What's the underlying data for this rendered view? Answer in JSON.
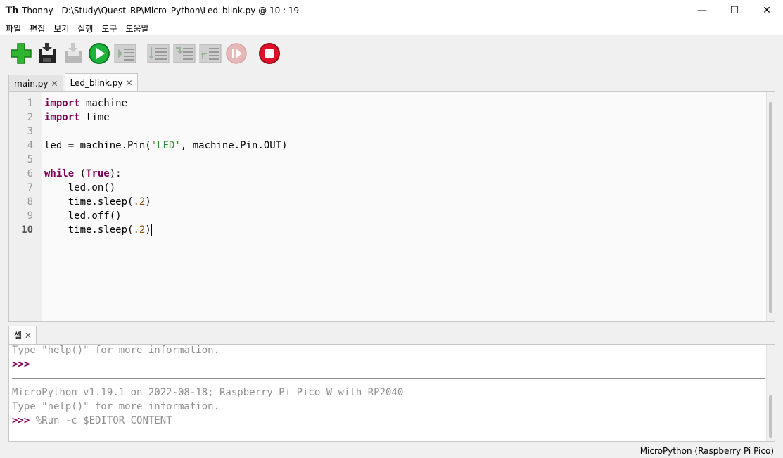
{
  "window": {
    "title": "Thonny  -  D:\\Study\\Quest_RP\\Micro_Python\\Led_blink.py  @  10 : 19",
    "minimize_glyph": "—",
    "maximize_glyph": "☐",
    "close_glyph": "✕"
  },
  "menu": {
    "items": [
      {
        "label": "파일"
      },
      {
        "label": "편집"
      },
      {
        "label": "보기"
      },
      {
        "label": "실행"
      },
      {
        "label": "도구"
      },
      {
        "label": "도움말"
      }
    ]
  },
  "toolbar": {
    "buttons": [
      {
        "icon": "new-file-icon",
        "enabled": true
      },
      {
        "icon": "save-icon",
        "enabled": true
      },
      {
        "icon": "load-icon",
        "enabled": false
      },
      {
        "icon": "run-icon",
        "enabled": true
      },
      {
        "icon": "debug-icon",
        "enabled": false
      },
      {
        "icon": "step-over-icon",
        "enabled": false
      },
      {
        "icon": "step-into-icon",
        "enabled": false
      },
      {
        "icon": "step-out-icon",
        "enabled": false
      },
      {
        "icon": "resume-icon",
        "enabled": false
      },
      {
        "icon": "stop-icon",
        "enabled": true
      }
    ],
    "colors": {
      "run": "#1bb33a",
      "stop": "#e0102a",
      "new": "#2fb52f"
    }
  },
  "editor": {
    "tabs": [
      {
        "label": "main.py",
        "active": false
      },
      {
        "label": "Led_blink.py",
        "active": true
      }
    ],
    "close_glyph": "✕",
    "line_numbers": [
      "1",
      "2",
      "3",
      "4",
      "5",
      "6",
      "7",
      "8",
      "9",
      "10"
    ],
    "current_line": "10"
  },
  "shell": {
    "tab_label": "셸",
    "close_glyph": "✕",
    "help_text": "Type \"help()\" for more information.",
    "prompt": ">>>",
    "banner": "MicroPython v1.19.1 on 2022-08-18; Raspberry Pi Pico W with RP2040",
    "help_text_2": "Type \"help()\" for more information.",
    "last_command": "%Run -c $EDITOR_CONTENT"
  },
  "status": {
    "interpreter": "MicroPython (Raspberry Pi Pico)"
  }
}
